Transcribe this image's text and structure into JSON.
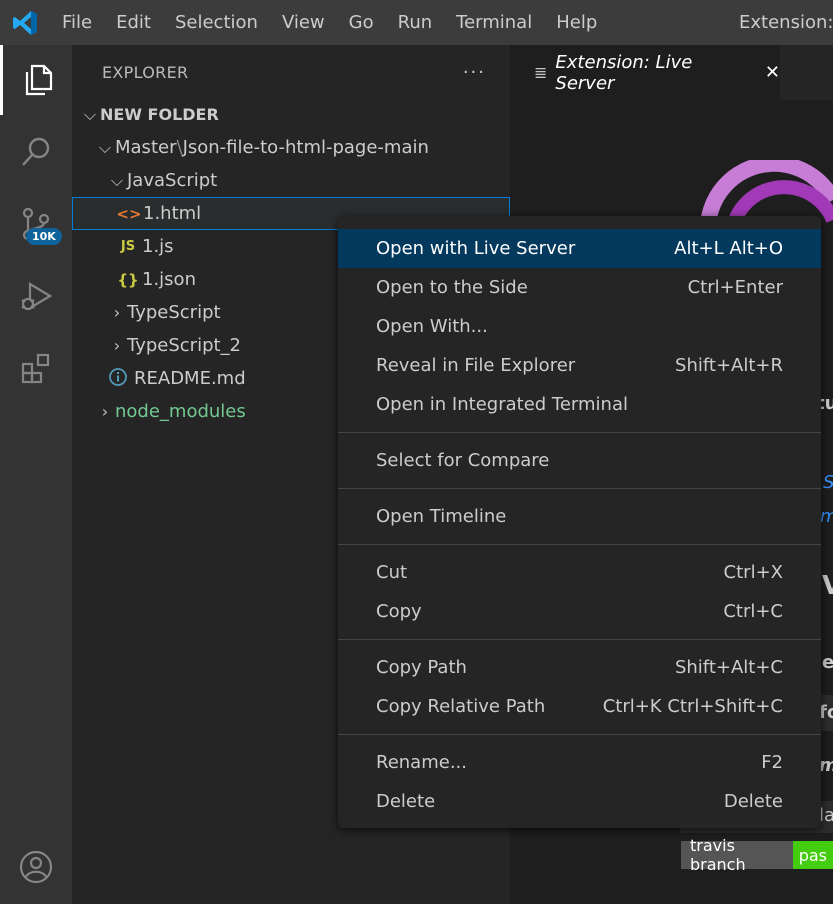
{
  "menubar": {
    "items": [
      "File",
      "Edit",
      "Selection",
      "View",
      "Go",
      "Run",
      "Terminal",
      "Help"
    ],
    "window_title": "Extension: L"
  },
  "activitybar": {
    "icons": [
      "files-icon",
      "search-icon",
      "source-control-icon",
      "run-debug-icon",
      "extensions-icon",
      "account-icon"
    ],
    "scm_badge": "10K"
  },
  "explorer": {
    "header": "EXPLORER",
    "more": "···",
    "folder_title": "NEW FOLDER",
    "path_master": "Master",
    "path_separator": "\\",
    "path_project": "Json-file-to-html-page-main",
    "javascript": "JavaScript",
    "file_html": "1.html",
    "file_js": "1.js",
    "file_json": "1.json",
    "typescript": "TypeScript",
    "typescript_2": "TypeScript_2",
    "readme": "README.md",
    "node_modules": "node_modules"
  },
  "file_icons": {
    "html": "<>",
    "js": "JS",
    "json": "{}",
    "readme": "i"
  },
  "editor": {
    "tab_label": "Extension: Live Server",
    "badge_left": "travis branch",
    "badge_right": "pas",
    "peek_tu": "tu",
    "peek_s": "S",
    "peek_m": "m",
    "peek_v": "V",
    "peek_es": "es",
    "peek_fo": "fo",
    "peek_m2": "m",
    "peek_la": "la"
  },
  "context_menu": {
    "open_live_server": {
      "label": "Open with Live Server",
      "shortcut": "Alt+L Alt+O"
    },
    "open_side": {
      "label": "Open to the Side",
      "shortcut": "Ctrl+Enter"
    },
    "open_with": {
      "label": "Open With...",
      "shortcut": ""
    },
    "reveal": {
      "label": "Reveal in File Explorer",
      "shortcut": "Shift+Alt+R"
    },
    "open_terminal": {
      "label": "Open in Integrated Terminal",
      "shortcut": ""
    },
    "compare": {
      "label": "Select for Compare",
      "shortcut": ""
    },
    "timeline": {
      "label": "Open Timeline",
      "shortcut": ""
    },
    "cut": {
      "label": "Cut",
      "shortcut": "Ctrl+X"
    },
    "copy": {
      "label": "Copy",
      "shortcut": "Ctrl+C"
    },
    "copy_path": {
      "label": "Copy Path",
      "shortcut": "Shift+Alt+C"
    },
    "copy_rel_path": {
      "label": "Copy Relative Path",
      "shortcut": "Ctrl+K Ctrl+Shift+C"
    },
    "rename": {
      "label": "Rename...",
      "shortcut": "F2"
    },
    "delete": {
      "label": "Delete",
      "shortcut": "Delete"
    }
  },
  "colors": {
    "accent": "#007fd4",
    "menu_highlight": "#04395e",
    "html_icon": "#e37933",
    "js_icon": "#cbcb41",
    "readme_icon": "#519aba",
    "node_modules_text": "#73c991",
    "live_server_logo": "#a23ab8"
  }
}
